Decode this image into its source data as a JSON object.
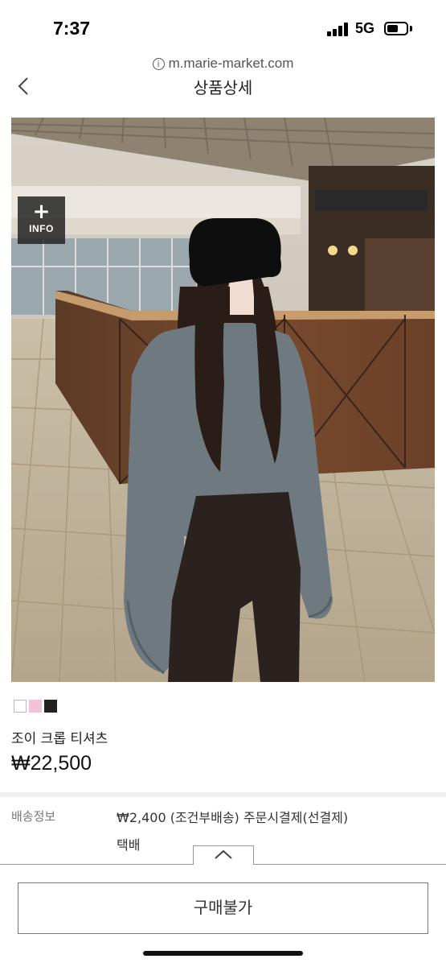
{
  "status_bar": {
    "time": "7:37",
    "network": "5G",
    "battery_fraction": 0.5
  },
  "browser": {
    "url": "m.marie-market.com"
  },
  "header": {
    "title": "상품상세"
  },
  "image_overlay": {
    "badge_symbol": "+",
    "badge_label": "INFO"
  },
  "product": {
    "color_swatches": [
      "#ffffff",
      "#f4c2d8",
      "#222222"
    ],
    "name": "조이 크롭 티셔츠",
    "price": "₩22,500"
  },
  "shipping": {
    "label": "배송정보",
    "info": "₩2,400 (조건부배송) 주문시결제(선결제)",
    "method": "택배"
  },
  "purchase": {
    "button_label": "구매불가"
  },
  "icons": {
    "back": "chevron-left-icon",
    "collapse": "chevron-up-icon",
    "site_info": "info-circle-icon"
  }
}
